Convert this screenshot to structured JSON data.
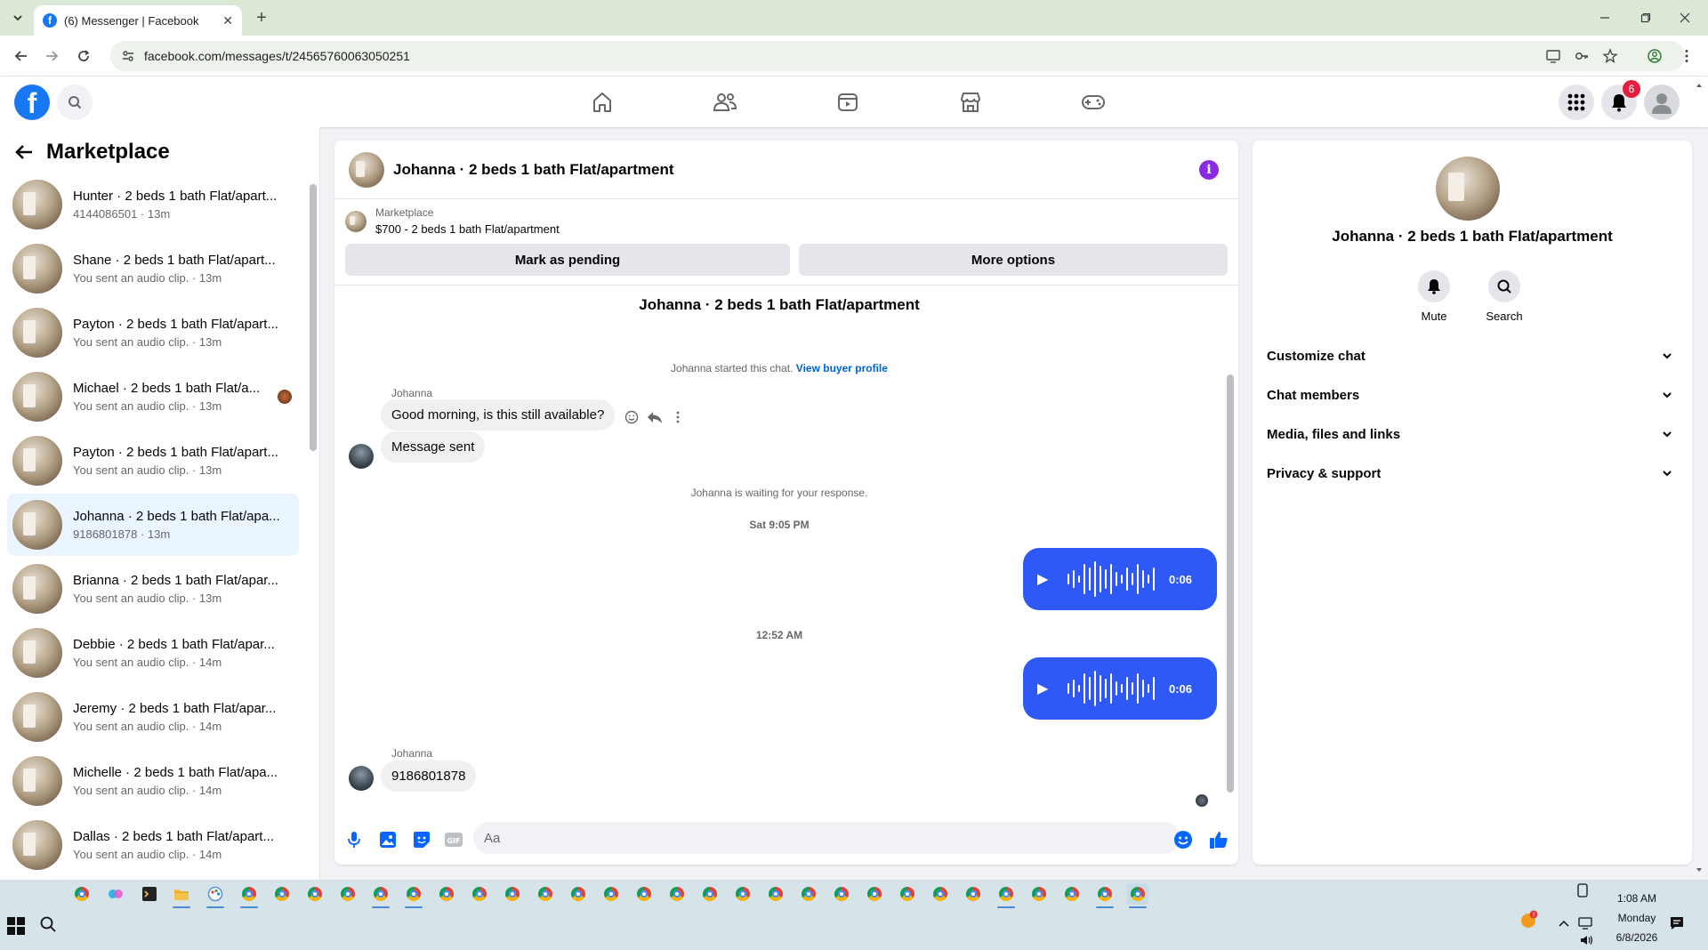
{
  "browser": {
    "tab_title": "(6) Messenger | Facebook",
    "url": "facebook.com/messages/t/24565760063050251",
    "tab_close": "✕",
    "new_tab": "+"
  },
  "fb": {
    "logo_letter": "f",
    "notification_count": "6"
  },
  "sidebar": {
    "title": "Marketplace",
    "conversations": [
      {
        "name": "Hunter · 2 beds 1 bath Flat/apart...",
        "sub": "4144086501 · 13m"
      },
      {
        "name": "Shane · 2 beds 1 bath Flat/apart...",
        "sub": "You sent an audio clip. · 13m"
      },
      {
        "name": "Payton · 2 beds 1 bath Flat/apart...",
        "sub": "You sent an audio clip. · 13m"
      },
      {
        "name": "Michael · 2 beds 1 bath Flat/a...",
        "sub": "You sent an audio clip. · 13m"
      },
      {
        "name": "Payton · 2 beds 1 bath Flat/apart...",
        "sub": "You sent an audio clip. · 13m"
      },
      {
        "name": "Johanna · 2 beds 1 bath Flat/apa...",
        "sub": "9186801878 · 13m"
      },
      {
        "name": "Brianna · 2 beds 1 bath Flat/apar...",
        "sub": "You sent an audio clip. · 13m"
      },
      {
        "name": "Debbie · 2 beds 1 bath Flat/apar...",
        "sub": "You sent an audio clip. · 14m"
      },
      {
        "name": "Jeremy · 2 beds 1 bath Flat/apar...",
        "sub": "You sent an audio clip. · 14m"
      },
      {
        "name": "Michelle · 2 beds 1 bath Flat/apa...",
        "sub": "You sent an audio clip. · 14m"
      },
      {
        "name": "Dallas · 2 beds 1 bath Flat/apart...",
        "sub": "You sent an audio clip. · 14m"
      }
    ]
  },
  "chat": {
    "header_name": "Johanna · 2 beds 1 bath Flat/apartment",
    "listing_label": "Marketplace",
    "listing_price": "$700 - 2 beds 1 bath Flat/apartment",
    "mark_pending": "Mark as pending",
    "more_options": "More options",
    "thread_title": "Johanna · 2 beds 1 bath Flat/apartment",
    "started_text": "Johanna started this chat.",
    "view_profile": "View buyer profile",
    "sender_1": "Johanna",
    "msg_1": "Good morning, is this still available?",
    "msg_2": "Message sent",
    "waiting": "Johanna is waiting for your response.",
    "time_1": "Sat 9:05 PM",
    "audio_1_dur": "0:06",
    "time_2": "12:52 AM",
    "audio_2_dur": "0:06",
    "sender_2": "Johanna",
    "msg_3": "9186801878",
    "composer_placeholder": "Aa"
  },
  "info": {
    "name": "Johanna · 2 beds 1 bath Flat/apartment",
    "mute": "Mute",
    "search": "Search",
    "rows": [
      "Customize chat",
      "Chat members",
      "Media, files and links",
      "Privacy & support"
    ]
  },
  "taskbar": {
    "time": "1:08 AM",
    "day": "Monday",
    "date": "6/8/2026"
  }
}
